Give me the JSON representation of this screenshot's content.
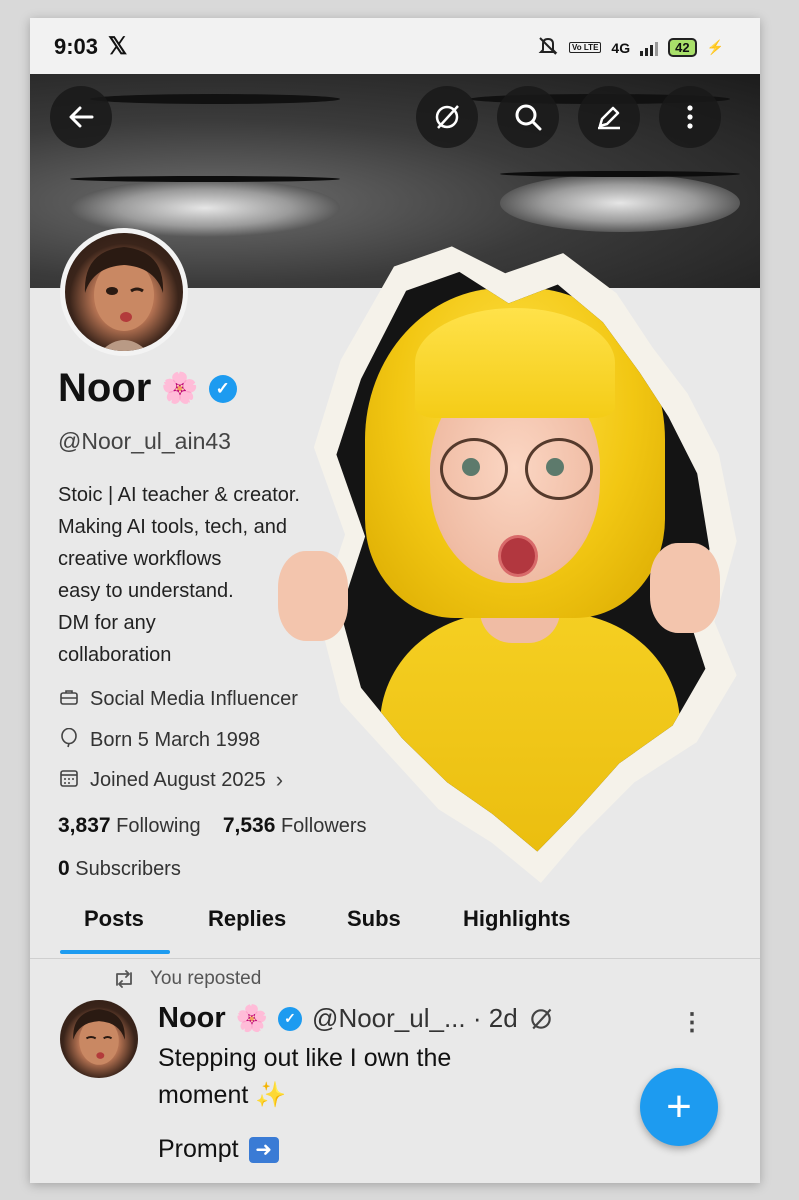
{
  "status_bar": {
    "time": "9:03",
    "x_logo": "𝕏",
    "vo_label": "Vo LTE",
    "network": "4G",
    "battery": "42",
    "charging_icon": "bolt-icon"
  },
  "header": {
    "buttons": [
      "back-arrow-icon",
      "grok-icon",
      "search-icon",
      "edit-icon",
      "more-vertical-icon"
    ]
  },
  "profile": {
    "name": "Noor",
    "name_emoji": "🌸",
    "handle": "@Noor_ul_ain43",
    "bio": [
      "Stoic | AI teacher & creator.",
      "Making AI tools, tech, and",
      "creative workflows",
      "easy to understand.",
      "DM for any",
      "collaboration"
    ],
    "category": "Social Media Influencer",
    "birthday": "Born 5 March 1998",
    "joined": "Joined August 2025",
    "following_count": "3,837",
    "following_label": "Following",
    "followers_count": "7,536",
    "followers_label": "Followers",
    "subscribers_count": "0",
    "subscribers_label": "Subscribers"
  },
  "tabs": [
    "Posts",
    "Replies",
    "Subs",
    "Highlights"
  ],
  "post": {
    "repost_label": "You reposted",
    "name": "Noor",
    "name_emoji": "🌸",
    "handle": "@Noor_ul_... · 2d",
    "text_line1": "Stepping out like I own the",
    "text_line2": "moment ✨",
    "prompt": "Prompt"
  },
  "fab": "+",
  "colors": {
    "accent": "#1d9bf0",
    "fill": "#e9e9e9"
  }
}
